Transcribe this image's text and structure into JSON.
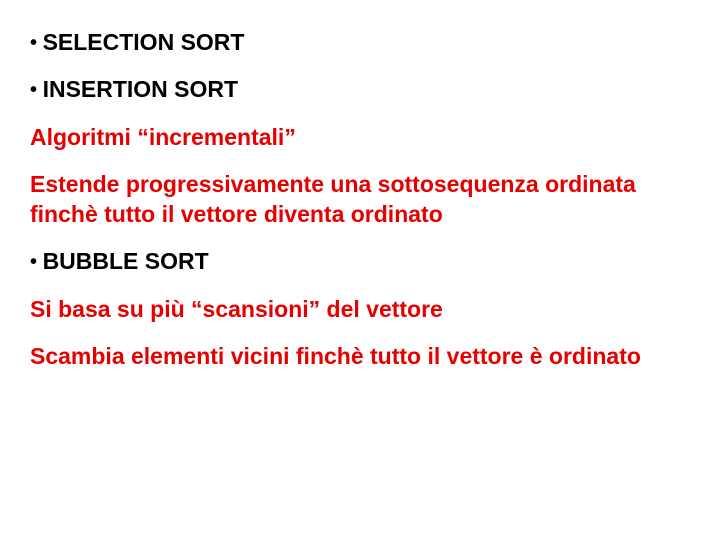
{
  "slide": {
    "bullets": {
      "selection": "SELECTION SORT",
      "insertion": "INSERTION SORT",
      "bubble": "BUBBLE SORT"
    },
    "text": {
      "incrementali": "Algoritmi “incrementali”",
      "estende": "Estende progressivamente una sottosequenza ordinata finchè tutto il vettore diventa ordinato",
      "scansioni": "Si basa su più “scansioni” del vettore",
      "scambia": "Scambia elementi vicini finchè tutto il vettore è ordinato"
    },
    "bullet_char": "• "
  }
}
